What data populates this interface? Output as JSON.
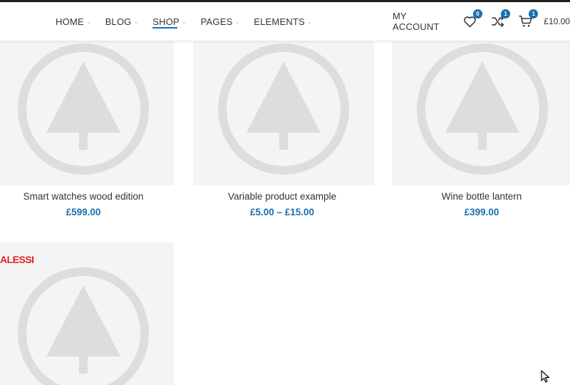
{
  "nav": {
    "items": [
      {
        "label": "HOME",
        "active": false
      },
      {
        "label": "BLOG",
        "active": false
      },
      {
        "label": "SHOP",
        "active": true
      },
      {
        "label": "PAGES",
        "active": false
      },
      {
        "label": "ELEMENTS",
        "active": false
      }
    ]
  },
  "header": {
    "account_label": "MY ACCOUNT",
    "wishlist_count": "0",
    "compare_count": "1",
    "cart_count": "1",
    "cart_total": "£10.00",
    "icons": [
      "heart-icon",
      "shuffle-icon",
      "cart-icon"
    ]
  },
  "products": [
    {
      "name": "Smart watches wood edition",
      "price": "£599.00"
    },
    {
      "name": "Variable product example",
      "price": "£5.00 – £15.00"
    },
    {
      "name": "Wine bottle lantern",
      "price": "£399.00"
    },
    {
      "name": "",
      "price": ""
    }
  ],
  "brand_logo": "ALESSI",
  "colors": {
    "accent": "#1a6fb0",
    "placeholder_bg": "#f4f4f4",
    "placeholder_icon": "#dddddd",
    "brand_red": "#e32222"
  }
}
